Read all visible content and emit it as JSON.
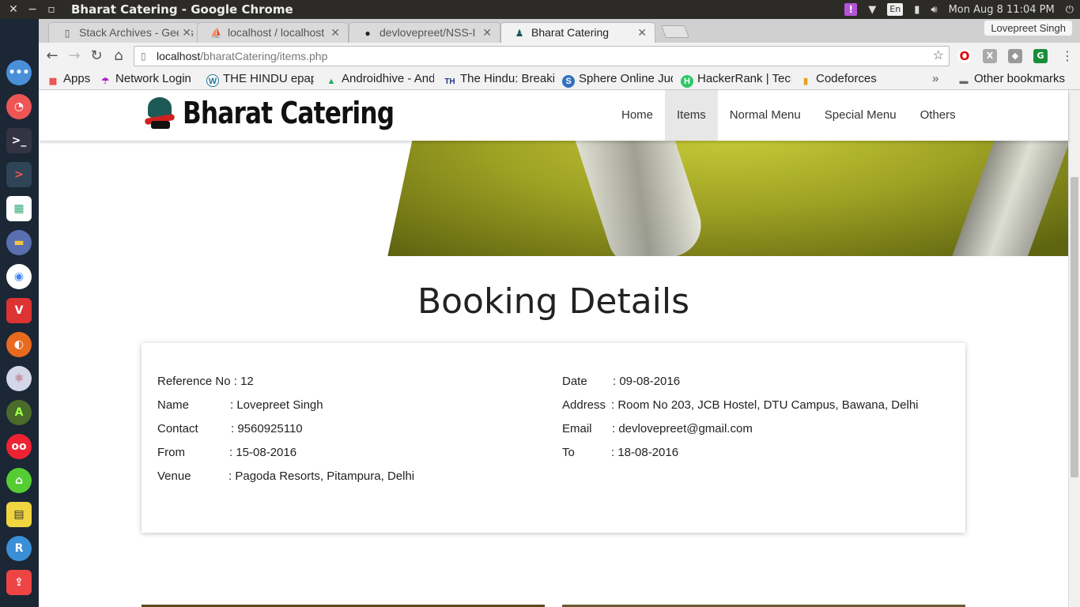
{
  "os": {
    "window_title": "Bharat Catering - Google Chrome",
    "clock": "Mon Aug  8 11:04 PM",
    "keyboard": "En",
    "notification_badge": "!"
  },
  "browser": {
    "tabs": [
      {
        "label": "Stack Archives - Geeks",
        "icon": "document-icon",
        "active": false
      },
      {
        "label": "localhost / localhost",
        "icon": "phpmyadmin-icon",
        "active": false
      },
      {
        "label": "devlovepreet/NSS-I",
        "icon": "github-icon",
        "active": false
      },
      {
        "label": "Bharat Catering",
        "icon": "chef-hat-icon",
        "active": true
      }
    ],
    "profile": "Lovepreet Singh",
    "url_host": "localhost",
    "url_path": "/bharatCatering/items.php",
    "bookmarks": [
      {
        "label": "Apps",
        "icon": "apps-grid-icon"
      },
      {
        "label": "Network Login",
        "icon": "umbrella-icon"
      },
      {
        "label": "THE HINDU epaper",
        "icon": "wordpress-icon"
      },
      {
        "label": "Androidhive - Android",
        "icon": "androidhive-icon"
      },
      {
        "label": "The Hindu: Breaking",
        "icon": "the-hindu-icon"
      },
      {
        "label": "Sphere Online Judge",
        "icon": "spoj-icon"
      },
      {
        "label": "HackerRank | Tech",
        "icon": "hackerrank-icon"
      },
      {
        "label": "Codeforces",
        "icon": "codeforces-icon"
      }
    ],
    "other_bookmarks": "Other bookmarks",
    "overflow": "»"
  },
  "site": {
    "brand": "Bharat Catering",
    "nav": [
      {
        "label": "Home",
        "active": false
      },
      {
        "label": "Items",
        "active": true
      },
      {
        "label": "Normal Menu",
        "active": false
      },
      {
        "label": "Special Menu",
        "active": false
      },
      {
        "label": "Others",
        "active": false
      }
    ],
    "heading": "Booking Details",
    "left_fields": [
      {
        "label": "Reference No",
        "sep": " : ",
        "value": "12"
      },
      {
        "label": "Name",
        "sep": ": ",
        "value": "Lovepreet Singh"
      },
      {
        "label": "Contact",
        "sep": ": ",
        "value": "9560925110"
      },
      {
        "label": "From",
        "sep": ": ",
        "value": "15-08-2016"
      },
      {
        "label": "Venue",
        "sep": ": ",
        "value": "Pagoda Resorts, Pitampura, Delhi"
      }
    ],
    "right_fields": [
      {
        "label": "Date",
        "sep": ": ",
        "value": "09-08-2016"
      },
      {
        "label": "Address",
        "sep": ": ",
        "value": "Room No 203, JCB Hostel, DTU Campus, Bawana, Delhi"
      },
      {
        "label": "Email",
        "sep": ": ",
        "value": "devlovepreet@gmail.com"
      },
      {
        "label": "To",
        "sep": ": ",
        "value": "18-08-2016"
      }
    ]
  },
  "colors": {
    "launcher_bg": "#1b2735",
    "os_bar_bg": "#2c2b27",
    "nav_active_bg": "#e7e7e7",
    "cloth_green": "#9ea123"
  }
}
